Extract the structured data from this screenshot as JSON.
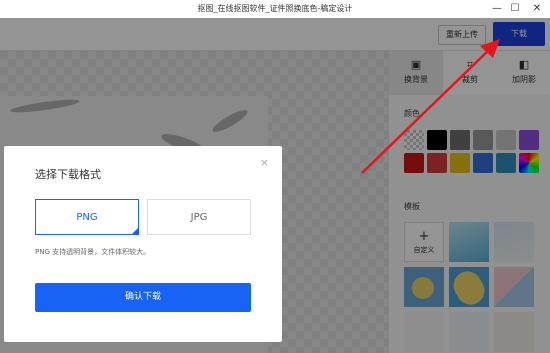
{
  "window": {
    "title": "抠图_在线抠图软件_证件照换底色-稿定设计",
    "minimize": "—",
    "maximize": "☐",
    "close": "✕"
  },
  "toolbar": {
    "reupload_label": "重新上传",
    "download_label": "下载"
  },
  "sidebar": {
    "tabs": [
      {
        "label": "换背景",
        "icon": "background-swap-icon",
        "active": true
      },
      {
        "label": "裁剪",
        "icon": "crop-icon",
        "active": false
      },
      {
        "label": "加阴影",
        "icon": "shadow-icon",
        "active": false
      }
    ],
    "color_section_label": "颜色",
    "template_section_label": "模板",
    "custom_label": "自定义",
    "swatches": [
      "transparent",
      "#000000",
      "#6f6f6f",
      "#9a9a9a",
      "#c8c8c8",
      "#8a4de0",
      "#c81818",
      "#d83a3a",
      "#e8c21a",
      "#2f6fd6",
      "#2e8fb8",
      "rainbow"
    ]
  },
  "dialog": {
    "title": "选择下载格式",
    "close": "×",
    "formats": [
      {
        "label": "PNG",
        "selected": true
      },
      {
        "label": "JPG",
        "selected": false
      }
    ],
    "note": "PNG 支持透明背景，文件体积较大。",
    "confirm_label": "确认下载"
  },
  "colors": {
    "accent": "#1763f5",
    "download_button": "#1d3fe0",
    "arrow": "#e3161b"
  }
}
